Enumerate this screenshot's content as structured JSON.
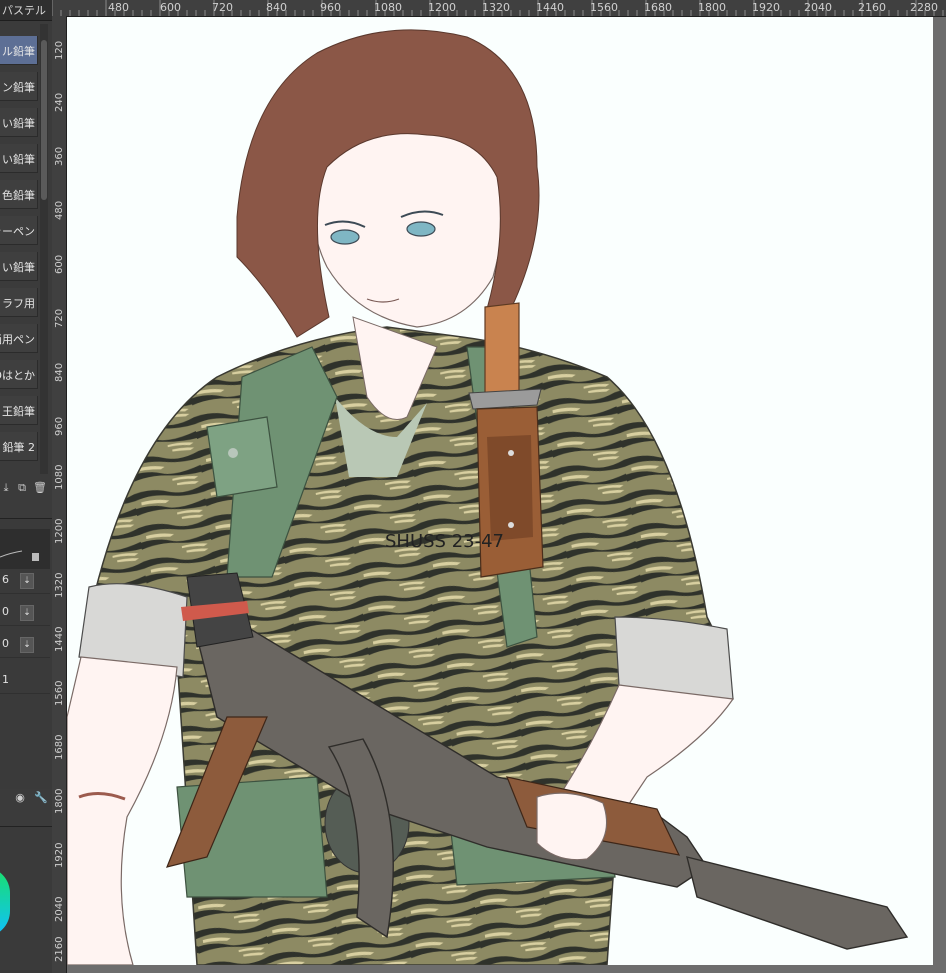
{
  "panel": {
    "tab_label": "パステル",
    "brushes": [
      {
        "label": "ル鉛筆",
        "selected": true
      },
      {
        "label": "ン鉛筆",
        "selected": false
      },
      {
        "label": "い鉛筆",
        "selected": false
      },
      {
        "label": "い鉛筆",
        "selected": false
      },
      {
        "label": "色鉛筆",
        "selected": false
      },
      {
        "label": "ャーペン",
        "selected": false
      },
      {
        "label": "い鉛筆",
        "selected": false
      },
      {
        "label": "ラフ用",
        "selected": false
      },
      {
        "label": "画用ペン",
        "selected": false
      },
      {
        "label": "Dはとか",
        "selected": false
      },
      {
        "label": "王鉛筆",
        "selected": false
      },
      {
        "label": "鉛筆 2",
        "selected": false
      }
    ],
    "props": [
      "6",
      "0",
      "0",
      "1"
    ]
  },
  "ruler": {
    "top_labels": [
      "480",
      "600",
      "720",
      "840",
      "960",
      "1080",
      "1200",
      "1320",
      "1440",
      "1560",
      "1680",
      "1800",
      "1920",
      "2040",
      "2160",
      "2280"
    ],
    "left_labels": [
      "120",
      "240",
      "360",
      "480",
      "600",
      "720",
      "840",
      "960",
      "1080",
      "1200",
      "1320",
      "1440",
      "1560",
      "1680",
      "1800",
      "1920",
      "2040",
      "2160"
    ]
  },
  "canvas": {
    "shirt_text": "SHUSS 23-47"
  },
  "colors": {
    "panel_bg": "#3b3b3b",
    "selected_brush": "#5d6f95",
    "canvas_bg": "#fafffe",
    "hair": "#8b5747",
    "skin": "#fff4f2",
    "strap_green": "#6f9273",
    "rifle_metal": "#6a6661",
    "rifle_wood": "#8d5b3c"
  },
  "icons": [
    "brush-delete-icon",
    "brush-copy-icon",
    "brush-add-icon",
    "lock-icon",
    "wrench-icon",
    "dial-icon"
  ]
}
